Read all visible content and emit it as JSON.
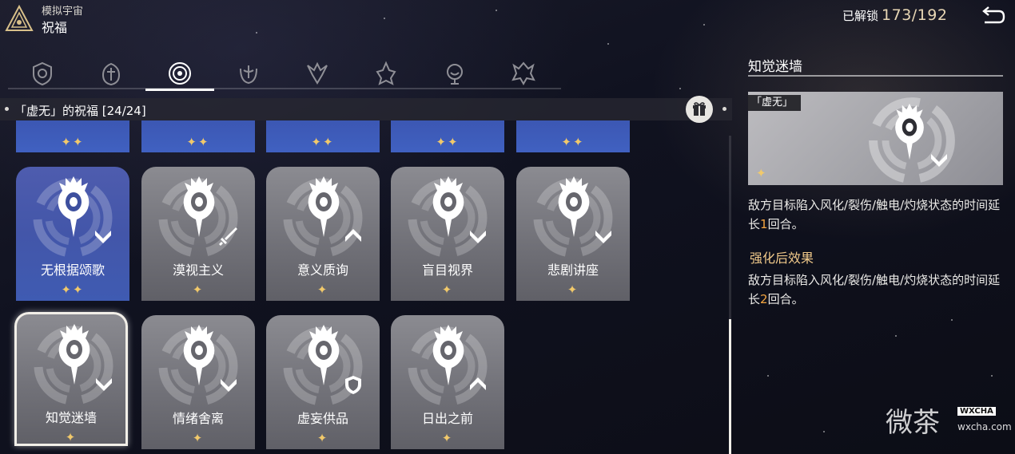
{
  "header": {
    "mode_label": "模拟宇宙",
    "title": "祝福",
    "unlock_label": "已解锁",
    "unlock_count": "173/192"
  },
  "tabs": [
    {
      "icon": "preservation-path-icon",
      "active": false
    },
    {
      "icon": "remembrance-path-icon",
      "active": false
    },
    {
      "icon": "nihility-path-icon",
      "active": true
    },
    {
      "icon": "abundance-path-icon",
      "active": false
    },
    {
      "icon": "the-hunt-path-icon",
      "active": false
    },
    {
      "icon": "destruction-path-icon",
      "active": false
    },
    {
      "icon": "elation-path-icon",
      "active": false
    },
    {
      "icon": "propagation-path-icon",
      "active": false
    }
  ],
  "path_bar": {
    "text": "「虚无」的祝福 [24/24]",
    "gift_icon": "gift-icon"
  },
  "top_row_cards": [
    {
      "stars": "✦✦"
    },
    {
      "stars": "✦✦"
    },
    {
      "stars": "✦✦"
    },
    {
      "stars": "✦✦"
    },
    {
      "stars": "✦✦"
    }
  ],
  "cards": [
    {
      "name": "无根据颂歌",
      "stars": "✦✦",
      "style": "blue",
      "path_icon": "chevron-down-icon"
    },
    {
      "name": "漠视主义",
      "stars": "✦",
      "style": "gray",
      "path_icon": "sword-icon"
    },
    {
      "name": "意义质询",
      "stars": "✦",
      "style": "gray",
      "path_icon": "chevron-up-icon"
    },
    {
      "name": "盲目视界",
      "stars": "✦",
      "style": "gray",
      "path_icon": "chevron-down-icon"
    },
    {
      "name": "悲剧讲座",
      "stars": "✦",
      "style": "gray",
      "path_icon": "chevron-down-icon"
    },
    {
      "name": "知觉迷墙",
      "stars": "✦",
      "style": "gray",
      "path_icon": "chevron-down-icon",
      "selected": true
    },
    {
      "name": "情绪舍离",
      "stars": "✦",
      "style": "gray",
      "path_icon": "chevron-down-icon"
    },
    {
      "name": "虚妄供品",
      "stars": "✦",
      "style": "gray",
      "path_icon": "shield-icon"
    },
    {
      "name": "日出之前",
      "stars": "✦",
      "style": "gray",
      "path_icon": "chevron-up-icon"
    }
  ],
  "detail": {
    "title": "知觉迷墙",
    "tag": "「虚无」",
    "star": "✦",
    "desc_before": "敌方目标陷入风化/裂伤/触电/灼烧状态的时间延长",
    "desc_num": "1",
    "desc_after": "回合。",
    "enhanced_title": "强化后效果",
    "enh_before": "敌方目标陷入风化/裂伤/触电/灼烧状态的时间延长",
    "enh_num": "2",
    "enh_after": "回合。"
  },
  "watermark": {
    "text": "微茶",
    "tag": "WXCHA",
    "url": "wxcha.com"
  },
  "colors": {
    "accent_gold": "#f1c96b",
    "highlight_orange": "#f3a540",
    "enhanced_title": "#f0c98a",
    "blue_card": "#4356a9",
    "gray_card": "#727279"
  }
}
